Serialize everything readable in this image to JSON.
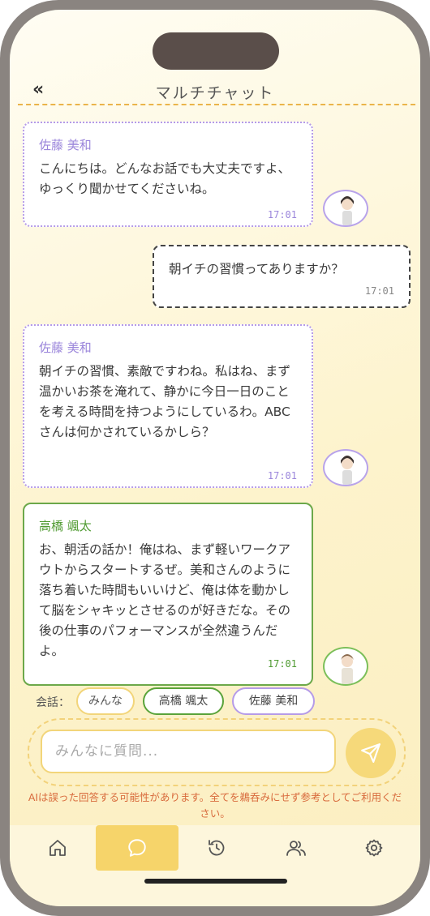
{
  "header": {
    "back_label": "«",
    "title": "マルチチャット"
  },
  "messages": [
    {
      "sender": "佐藤 美和",
      "text": "こんにちは。どんなお話でも大丈夫ですよ、ゆっくり聞かせてくださいね。",
      "time": "17:01"
    },
    {
      "sender": "",
      "text": "朝イチの習慣ってありますか？",
      "time": "17:01"
    },
    {
      "sender": "佐藤 美和",
      "text": "朝イチの習慣、素敵ですわね。私はね、まず温かいお茶を淹れて、静かに今日一日のことを考える時間を持つようにしているわ。ABCさんは何かされているかしら？",
      "time": "17:01"
    },
    {
      "sender": "高橋 颯太",
      "text": "お、朝活の話か！俺はね、まず軽いワークアウトからスタートするぜ。美和さんのように落ち着いた時間もいいけど、俺は体を動かして脳をシャキッとさせるのが好きだな。その後の仕事のパフォーマンスが全然違うんだよ。",
      "time": "17:01"
    }
  ],
  "chips": {
    "label": "会話：",
    "all": "みんな",
    "sota": "高橋 颯太",
    "misaki": "佐藤 美和"
  },
  "input": {
    "placeholder": "みんなに質問..."
  },
  "disclaimer": "AIは誤った回答する可能性があります。全てを鵜呑みにせず参考としてご利用ください。",
  "nav": {
    "active": "chat",
    "icons": [
      "home-icon",
      "chat-icon",
      "history-icon",
      "users-icon",
      "settings-icon"
    ]
  },
  "colors": {
    "accent": "#f6d46a",
    "misaki": "#b59be8",
    "sota": "#5aa33a"
  }
}
